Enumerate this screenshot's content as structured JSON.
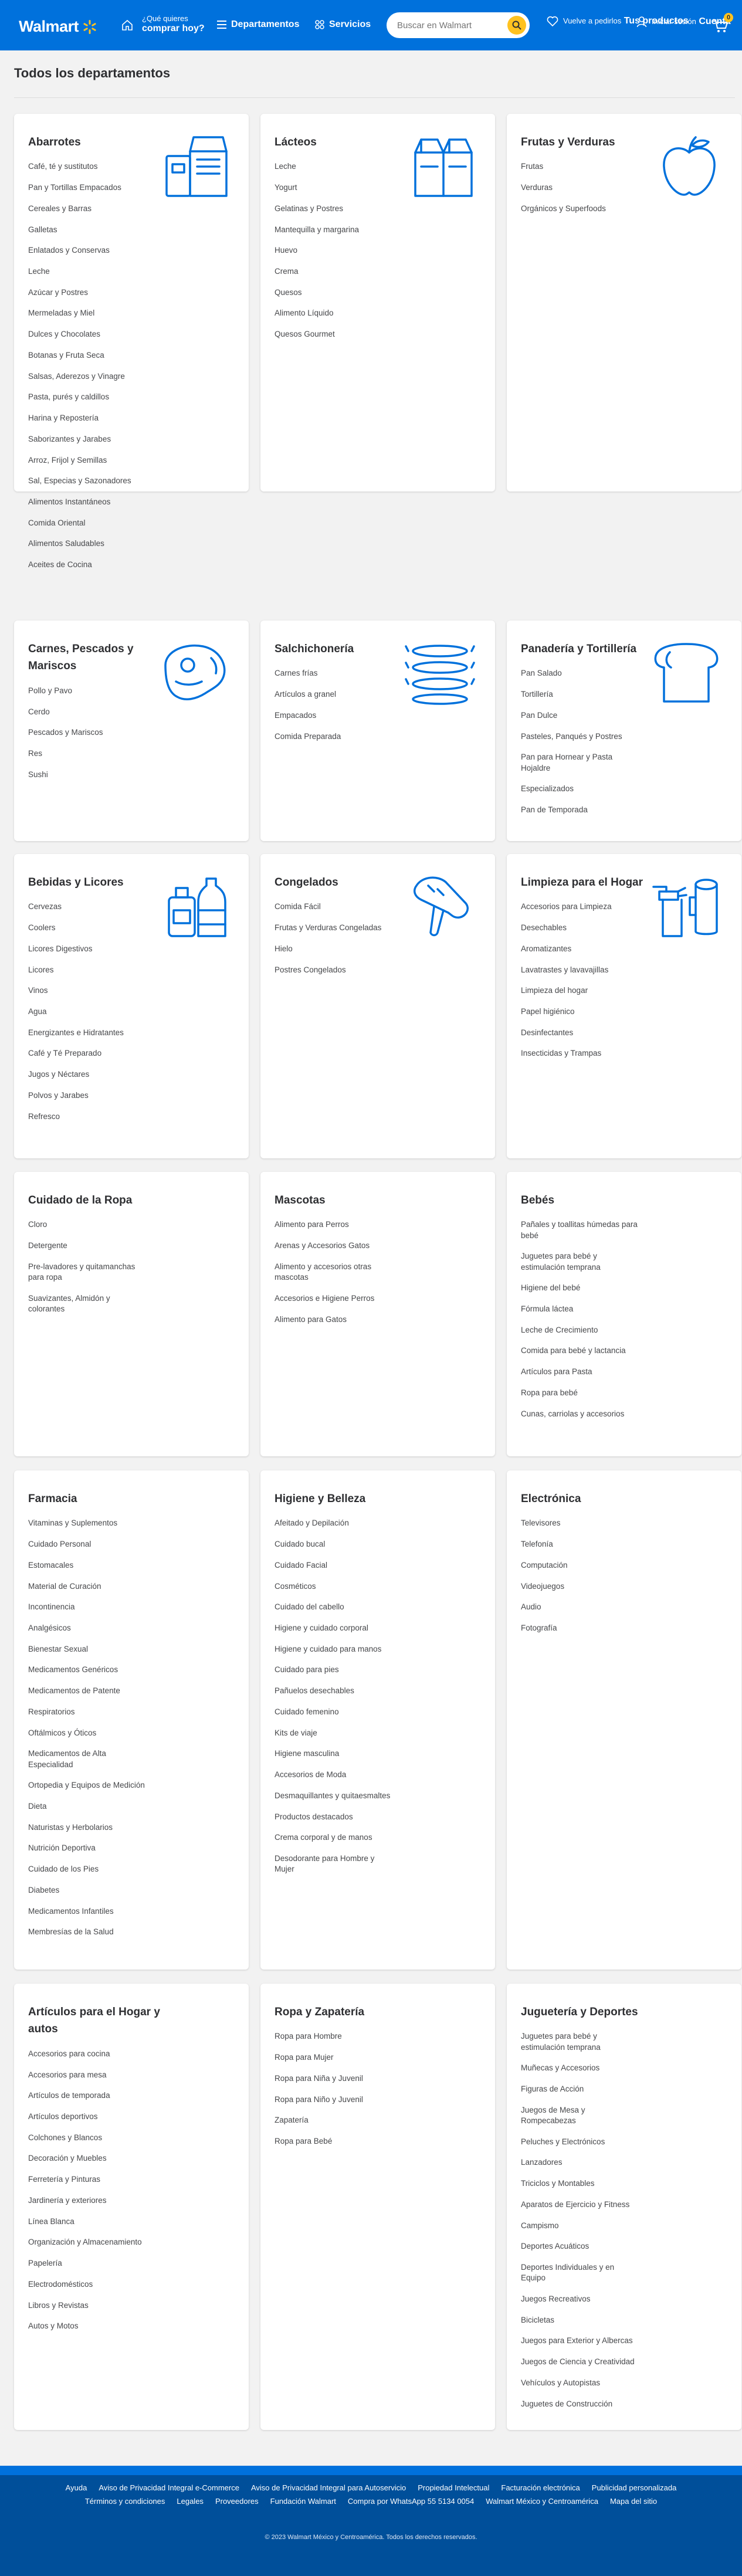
{
  "header": {
    "logo_text": "Walmart",
    "pickup_small": "¿Qué quieres",
    "pickup_big": "comprar hoy?",
    "departments": "Departamentos",
    "services": "Servicios",
    "search_placeholder": "Buscar en Walmart",
    "fav_small": "Vuelve a pedirlos",
    "fav_big": "Tus productos",
    "account_small": "Iniciar sesión",
    "account_big": "Cuenta",
    "cart_count": "0",
    "colors": {
      "brand": "#0071dc",
      "spark": "#ffc220"
    }
  },
  "page_title": "Todos los departamentos",
  "departments": [
    {
      "title": "Abarrotes",
      "icon": "pantry-icon",
      "items": [
        "Café, té y sustitutos",
        "Pan y Tortillas Empacados",
        "Cereales y Barras",
        "Galletas",
        "Enlatados y Conservas",
        "Leche",
        "Azúcar y Postres",
        "Mermeladas y Miel",
        "Dulces y Chocolates",
        "Botanas y Fruta Seca",
        "Salsas, Aderezos y Vinagre",
        "Pasta, purés y caldillos",
        "Harina y Repostería",
        "Saborizantes y Jarabes",
        "Arroz, Frijol y Semillas",
        "Sal, Especias y Sazonadores",
        "Alimentos Instantáneos",
        "Comida Oriental",
        "Alimentos Saludables",
        "Aceites de Cocina"
      ]
    },
    {
      "title": "Lácteos",
      "icon": "milk-cartons-icon",
      "items": [
        "Leche",
        "Yogurt",
        "Gelatinas y Postres",
        "Mantequilla y margarina",
        "Huevo",
        "Crema",
        "Quesos",
        "Alimento Líquido",
        "Quesos Gourmet"
      ]
    },
    {
      "title": "Frutas y Verduras",
      "icon": "apple-icon",
      "items": [
        "Frutas",
        "Verduras",
        "Orgánicos y Superfoods"
      ]
    },
    {
      "title": "Carnes, Pescados y Mariscos",
      "icon": "steak-icon",
      "items": [
        "Pollo y Pavo",
        "Cerdo",
        "Pescados y Mariscos",
        "Res",
        "Sushi"
      ]
    },
    {
      "title": "Salchichonería",
      "icon": "sausages-icon",
      "items": [
        "Carnes frías",
        "Artículos a granel",
        "Empacados",
        "Comida Preparada"
      ]
    },
    {
      "title": "Panadería y Tortillería",
      "icon": "bread-icon",
      "items": [
        "Pan Salado",
        "Tortillería",
        "Pan Dulce",
        "Pasteles, Panqués y Postres",
        "Pan para Hornear y Pasta Hojaldre",
        "Especializados",
        "Pan de Temporada"
      ]
    },
    {
      "title": "Bebidas y Licores",
      "icon": "bottles-icon",
      "items": [
        "Cervezas",
        "Coolers",
        "Licores Digestivos",
        "Licores",
        "Vinos",
        "Agua",
        "Energizantes e Hidratantes",
        "Café y Té Preparado",
        "Jugos y Néctares",
        "Polvos y Jarabes",
        "Refresco"
      ]
    },
    {
      "title": "Congelados",
      "icon": "popsicle-icon",
      "items": [
        "Comida Fácil",
        "Frutas y Verduras Congeladas",
        "Hielo",
        "Postres Congelados"
      ]
    },
    {
      "title": "Limpieza para el Hogar",
      "icon": "cleaning-icon",
      "items": [
        "Accesorios para Limpieza",
        "Desechables",
        "Aromatizantes",
        "Lavatrastes y lavavajillas",
        "Limpieza del hogar",
        "Papel higiénico",
        "Desinfectantes",
        "Insecticidas y Trampas"
      ]
    },
    {
      "title": "Cuidado de la Ropa",
      "icon": "",
      "items": [
        "Cloro",
        "Detergente",
        "Pre-lavadores y quitamanchas para ropa",
        "Suavizantes, Almidón y colorantes"
      ]
    },
    {
      "title": "Mascotas",
      "icon": "",
      "items": [
        "Alimento para Perros",
        "Arenas y Accesorios Gatos",
        "Alimento y accesorios otras mascotas",
        "Accesorios e Higiene Perros",
        "Alimento para Gatos"
      ]
    },
    {
      "title": "Bebés",
      "icon": "",
      "items": [
        "Pañales y toallitas húmedas para bebé",
        "Juguetes para bebé y estimulación temprana",
        "Higiene del bebé",
        "Fórmula láctea",
        "Leche de Crecimiento",
        "Comida para bebé y lactancia",
        "Artículos para Pasta",
        "Ropa para bebé",
        "Cunas, carriolas y accesorios"
      ]
    },
    {
      "title": "Farmacia",
      "icon": "",
      "items": [
        "Vitaminas y Suplementos",
        "Cuidado Personal",
        "Estomacales",
        "Material de Curación",
        "Incontinencia",
        "Analgésicos",
        "Bienestar Sexual",
        "Medicamentos Genéricos",
        "Medicamentos de Patente",
        "Respiratorios",
        "Oftálmicos y Óticos",
        "Medicamentos de Alta Especialidad",
        "Ortopedia y Equipos de Medición",
        "Dieta",
        "Naturistas y Herbolarios",
        "Nutrición Deportiva",
        "Cuidado de los Pies",
        "Diabetes",
        "Medicamentos Infantiles",
        "Membresías de la Salud"
      ]
    },
    {
      "title": "Higiene y Belleza",
      "icon": "",
      "items": [
        "Afeitado y Depilación",
        "Cuidado bucal",
        "Cuidado Facial",
        "Cosméticos",
        "Cuidado del cabello",
        "Higiene y cuidado corporal",
        "Higiene y cuidado para manos",
        "Cuidado para pies",
        "Pañuelos desechables",
        "Cuidado femenino",
        "Kits de viaje",
        "Higiene masculina",
        "Accesorios de Moda",
        "Desmaquillantes y quitaesmaltes",
        "Productos destacados",
        "Crema corporal y de manos",
        "Desodorante para Hombre y Mujer"
      ]
    },
    {
      "title": "Electrónica",
      "icon": "",
      "items": [
        "Televisores",
        "Telefonía",
        "Computación",
        "Videojuegos",
        "Audio",
        "Fotografía"
      ]
    },
    {
      "title": "Artículos para el Hogar y autos",
      "icon": "",
      "items": [
        "Accesorios para cocina",
        "Accesorios para mesa",
        "Artículos de temporada",
        "Artículos deportivos",
        "Colchones y Blancos",
        "Decoración y Muebles",
        "Ferretería y Pinturas",
        "Jardinería y exteriores",
        "Línea Blanca",
        "Organización y Almacenamiento",
        "Papelería",
        "Electrodomésticos",
        "Libros y Revistas",
        "Autos y Motos"
      ]
    },
    {
      "title": "Ropa y Zapatería",
      "icon": "",
      "items": [
        "Ropa para Hombre",
        "Ropa para Mujer",
        "Ropa para Niña y Juvenil",
        "Ropa para Niño y Juvenil",
        "Zapatería",
        "Ropa para Bebé"
      ]
    },
    {
      "title": "Juguetería y Deportes",
      "icon": "",
      "items": [
        "Juguetes para bebé y estimulación temprana",
        "Muñecas y Accesorios",
        "Figuras de Acción",
        "Juegos de Mesa y Rompecabezas",
        "Peluches y Electrónicos",
        "Lanzadores",
        "Triciclos y Montables",
        "Aparatos de Ejercicio y Fitness",
        "Campismo",
        "Deportes Acuáticos",
        "Deportes Individuales y en Equipo",
        "Juegos Recreativos",
        "Bicicletas",
        "Juegos para Exterior y Albercas",
        "Juegos de Ciencia y Creatividad",
        "Vehículos y Autopistas",
        "Juguetes de Construcción"
      ]
    }
  ],
  "footer": {
    "row1": [
      "Ayuda",
      "Aviso de Privacidad Integral e-Commerce",
      "Aviso de Privacidad Integral para Autoservicio",
      "Propiedad Intelectual",
      "Facturación electrónica",
      "Publicidad personalizada"
    ],
    "row2": [
      "Términos y condiciones",
      "Legales",
      "Proveedores",
      "Fundación Walmart",
      "Compra por WhatsApp 55 5134 0054",
      "Walmart México y Centroamérica",
      "Mapa del sitio"
    ],
    "copyright": "© 2023 Walmart México y Centroamérica. Todos los derechos reservados."
  }
}
